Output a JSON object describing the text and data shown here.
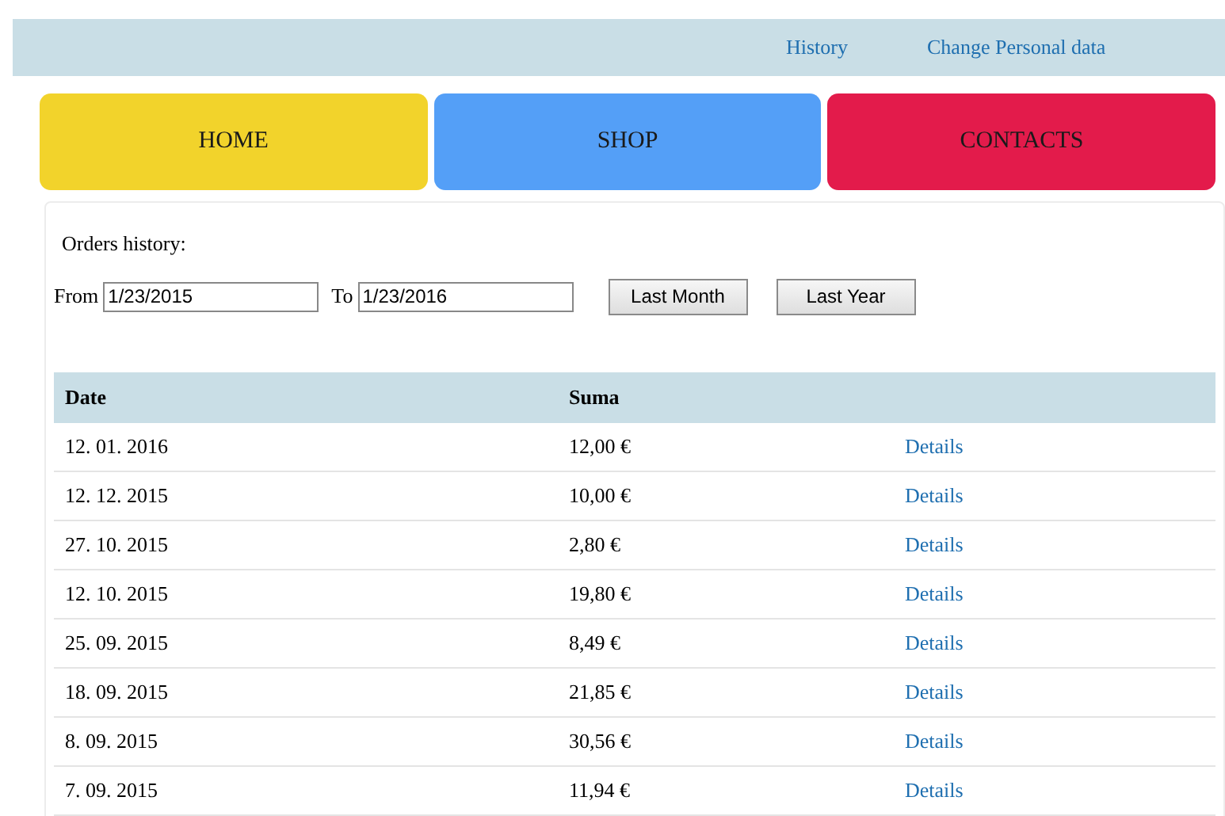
{
  "top_links": [
    "History",
    "Change Personal data"
  ],
  "nav": [
    {
      "label": "HOME",
      "color": "#f2d32b"
    },
    {
      "label": "SHOP",
      "color": "#549ff7"
    },
    {
      "label": "CONTACTS",
      "color": "#e31b4b"
    }
  ],
  "orders": {
    "title": "Orders history:",
    "from_label": "From",
    "from_value": "1/23/2015",
    "to_label": "To",
    "to_value": "1/23/2016",
    "buttons": [
      "Last Month",
      "Last Year"
    ]
  },
  "table": {
    "columns": [
      "Date",
      "Suma"
    ],
    "rows": [
      {
        "date": "12. 01. 2016",
        "sum": "12,00 €",
        "link": "Details"
      },
      {
        "date": "12. 12. 2015",
        "sum": "10,00 €",
        "link": "Details"
      },
      {
        "date": "27. 10. 2015",
        "sum": "2,80 €",
        "link": "Details"
      },
      {
        "date": "12. 10. 2015",
        "sum": "19,80 €",
        "link": "Details"
      },
      {
        "date": "25. 09. 2015",
        "sum": "8,49 €",
        "link": "Details"
      },
      {
        "date": "18. 09. 2015",
        "sum": "21,85 €",
        "link": "Details"
      },
      {
        "date": "8. 09. 2015",
        "sum": "30,56 €",
        "link": "Details"
      },
      {
        "date": "7. 09. 2015",
        "sum": "11,94 €",
        "link": "Details"
      }
    ]
  }
}
